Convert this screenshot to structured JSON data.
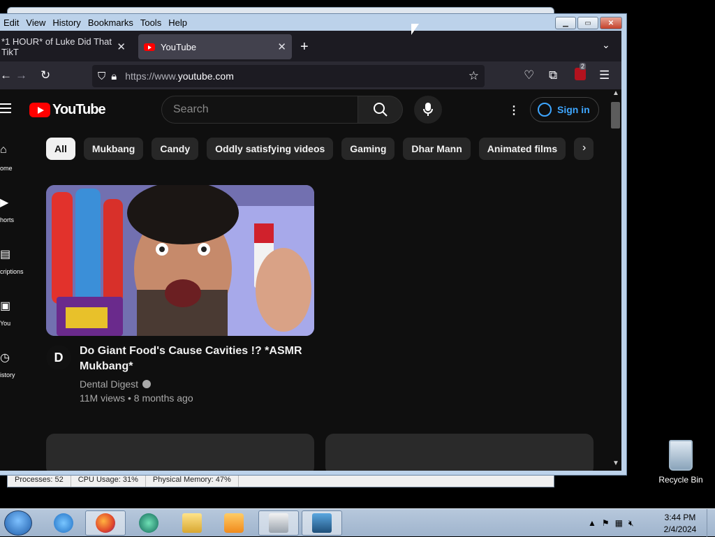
{
  "menubar": {
    "items": [
      "Edit",
      "View",
      "History",
      "Bookmarks",
      "Tools",
      "Help"
    ]
  },
  "tabs": [
    {
      "label": "*1 HOUR* of Luke Did That TikT",
      "active": false
    },
    {
      "label": "YouTube",
      "active": true
    }
  ],
  "urlbar": {
    "proto": "https://www.",
    "host": "youtube.com"
  },
  "extension_badge": "2",
  "youtube": {
    "logo_text": "YouTube",
    "search_placeholder": "Search",
    "sign_in": "Sign in",
    "chips": [
      "All",
      "Mukbang",
      "Candy",
      "Oddly satisfying videos",
      "Gaming",
      "Dhar Mann",
      "Animated films"
    ],
    "sidenav": [
      {
        "label": "ome",
        "icon": "home-icon"
      },
      {
        "label": "horts",
        "icon": "shorts-icon"
      },
      {
        "label": "criptions",
        "icon": "subscriptions-icon"
      },
      {
        "label": "You",
        "icon": "you-icon"
      },
      {
        "label": "istory",
        "icon": "history-icon"
      }
    ],
    "video": {
      "title": "Do Giant Food's Cause Cavities !? *ASMR Mukbang*",
      "channel": "Dental Digest",
      "views": "11M views",
      "age": "8 months ago",
      "meta": "11M views • 8 months ago",
      "avatar_text": "D"
    }
  },
  "bg_status": {
    "processes": "Processes: 52",
    "cpu": "CPU Usage: 31%",
    "memory": "Physical Memory: 47%"
  },
  "desktop": {
    "recycle_bin": "Recycle Bin"
  },
  "taskbar": {
    "time": "3:44 PM",
    "date": "2/4/2024"
  },
  "colors": {
    "yt_red": "#ff0000",
    "link_blue": "#3ea6ff",
    "page_bg": "#0f0f0f"
  }
}
